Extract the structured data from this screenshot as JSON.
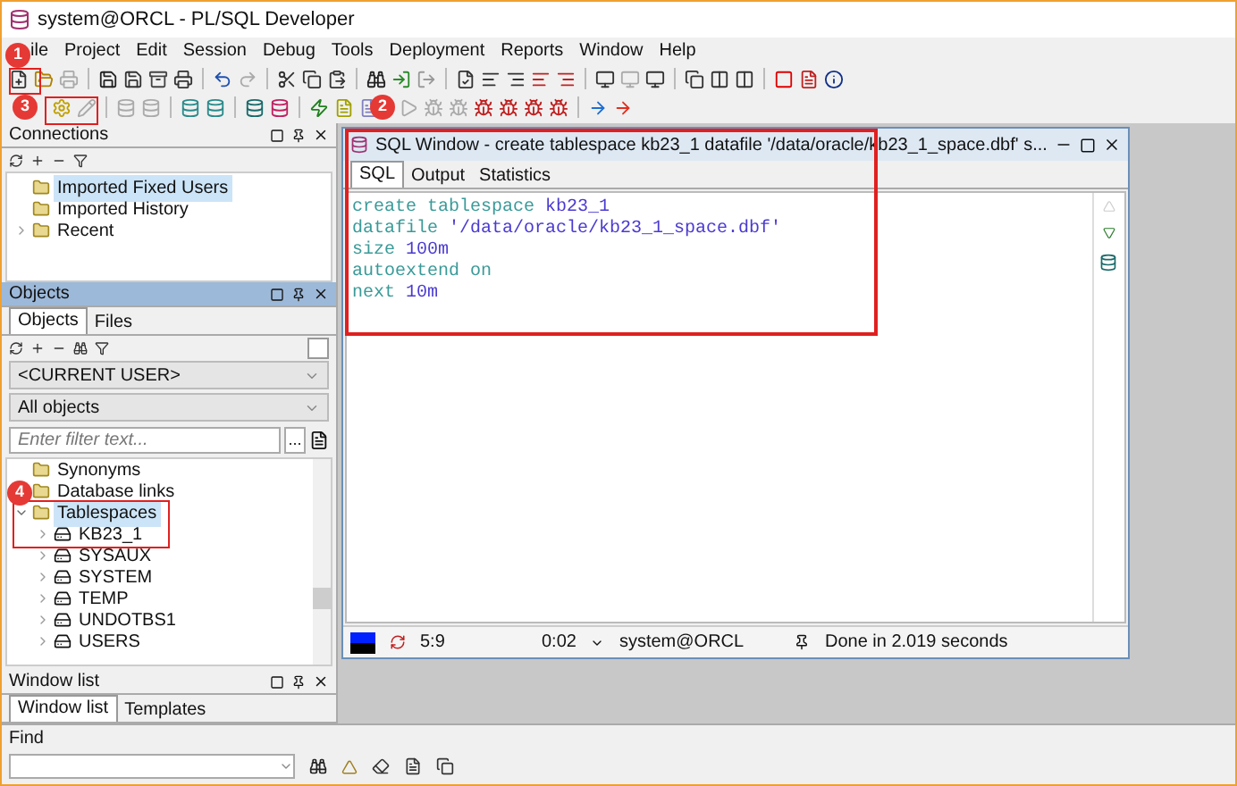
{
  "window": {
    "title": "system@ORCL - PL/SQL Developer"
  },
  "menu": [
    "ile",
    "Project",
    "Edit",
    "Session",
    "Debug",
    "Tools",
    "Deployment",
    "Reports",
    "Window",
    "Help"
  ],
  "annotations": [
    {
      "number": "1"
    },
    {
      "number": "3"
    },
    {
      "number": "2"
    },
    {
      "number": "4"
    }
  ],
  "connections": {
    "title": "Connections",
    "tree": [
      {
        "label": "Imported Fixed Users",
        "selected": true
      },
      {
        "label": "Imported History",
        "selected": false
      },
      {
        "label": "Recent",
        "selected": false,
        "expanded": false
      }
    ]
  },
  "objects": {
    "title": "Objects",
    "tabs": [
      {
        "label": "Objects",
        "selected": true
      },
      {
        "label": "Files",
        "selected": false
      }
    ],
    "option_checked": false,
    "user_select": "<CURRENT USER>",
    "type_select": "All objects",
    "filter": {
      "placeholder": "Enter filter text..."
    },
    "filter_button": "...",
    "tree": [
      {
        "label": "Synonyms",
        "selected": false
      },
      {
        "label": "Database links",
        "selected": false
      },
      {
        "label": "Tablespaces",
        "selected": true,
        "expanded": true,
        "children": [
          {
            "label": "KB23_1",
            "selected": false,
            "expanded": false
          },
          {
            "label": "SYSAUX",
            "selected": false,
            "expanded": false
          },
          {
            "label": "SYSTEM",
            "selected": false,
            "expanded": false
          },
          {
            "label": "TEMP",
            "selected": false,
            "expanded": false
          },
          {
            "label": "UNDOTBS1",
            "selected": false,
            "expanded": false
          },
          {
            "label": "USERS",
            "selected": false,
            "expanded": false
          }
        ]
      }
    ]
  },
  "window_list": {
    "title": "Window list",
    "tabs": [
      {
        "label": "Window list",
        "selected": true
      },
      {
        "label": "Templates",
        "selected": false
      }
    ]
  },
  "find": {
    "title": "Find"
  },
  "sql_window": {
    "title": "SQL Window - create tablespace kb23_1 datafile '/data/oracle/kb23_1_space.dbf' s...",
    "tabs": [
      {
        "label": "SQL",
        "selected": true
      },
      {
        "label": "Output",
        "selected": false
      },
      {
        "label": "Statistics",
        "selected": false
      }
    ],
    "code": [
      [
        {
          "text": "create tablespace",
          "kind": "keyword"
        },
        {
          "text": "kb23_1",
          "kind": "value"
        }
      ],
      [
        {
          "text": "datafile",
          "kind": "keyword"
        },
        {
          "text": "'/data/oracle/kb23_1_space.dbf'",
          "kind": "value"
        }
      ],
      [
        {
          "text": "size",
          "kind": "keyword"
        },
        {
          "text": "100m",
          "kind": "value"
        }
      ],
      [
        {
          "text": "autoextend on",
          "kind": "keyword"
        }
      ],
      [
        {
          "text": "next",
          "kind": "keyword"
        },
        {
          "text": "10m",
          "kind": "value"
        }
      ]
    ],
    "status": {
      "position": "5:9",
      "time": "0:02",
      "connection": "system@ORCL",
      "message": "Done in 2.019 seconds"
    }
  }
}
